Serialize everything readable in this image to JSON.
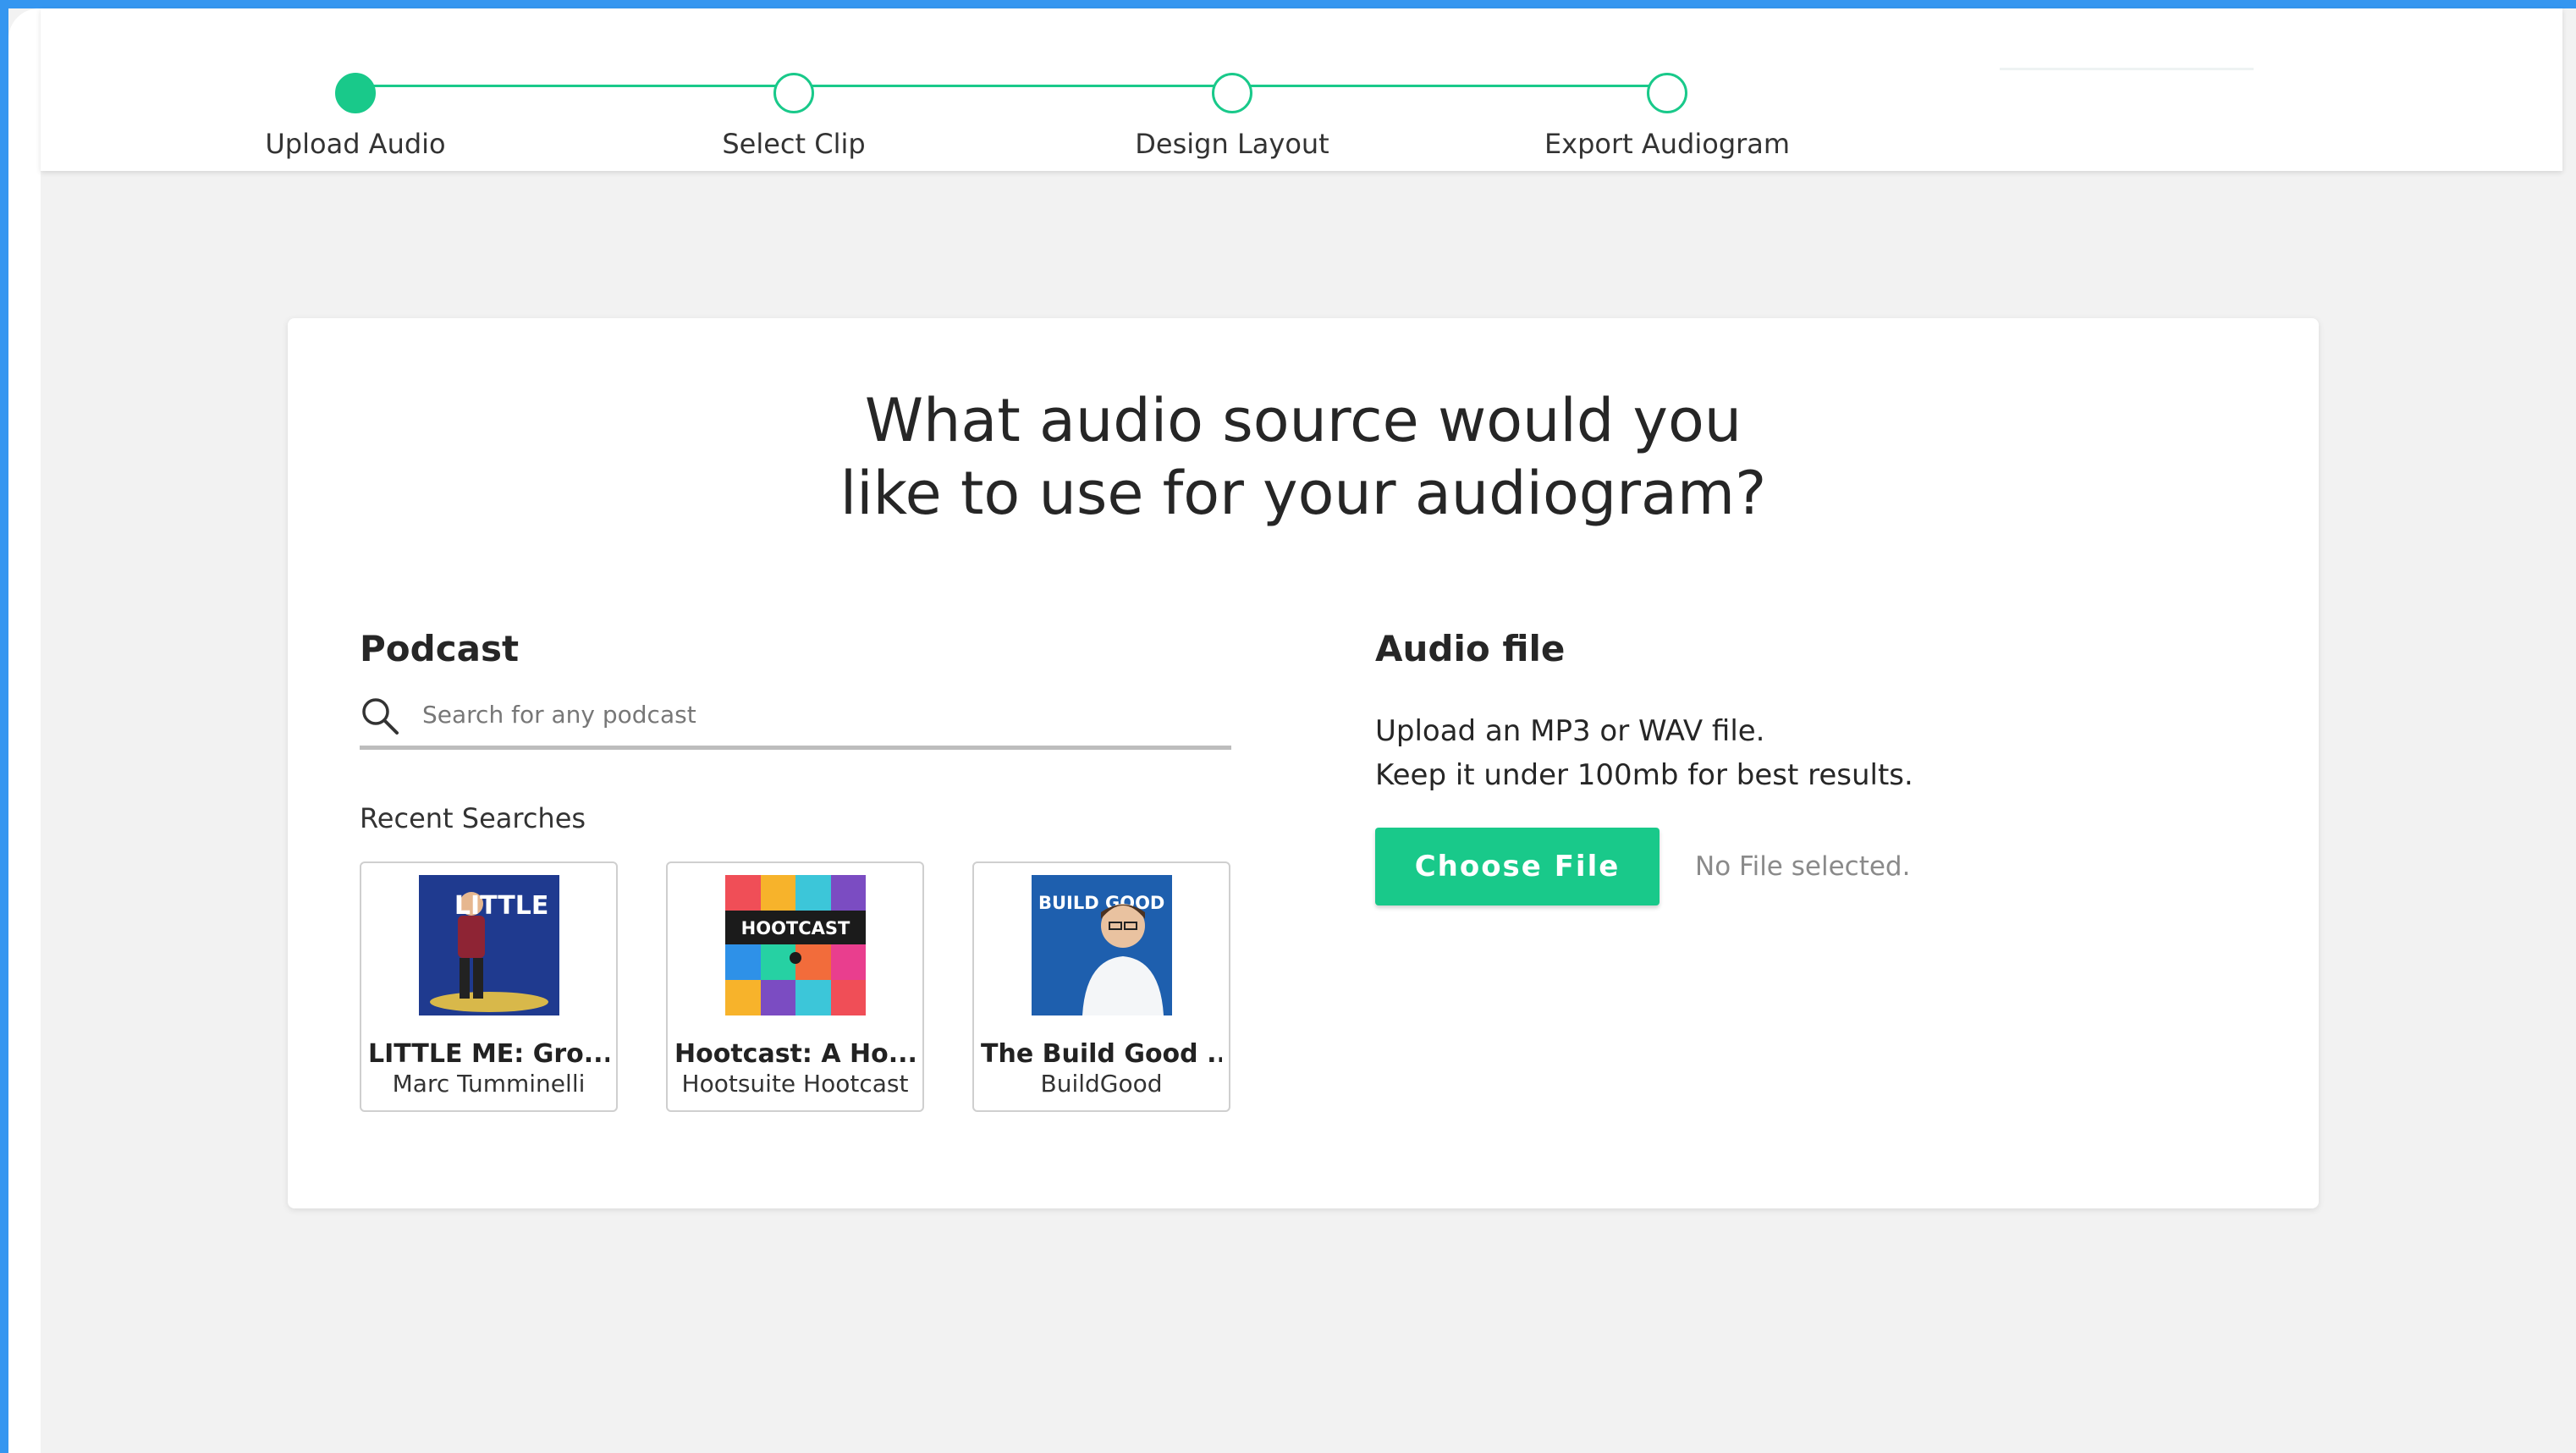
{
  "stepper": {
    "steps": [
      {
        "label": "Upload Audio",
        "active": true
      },
      {
        "label": "Select Clip",
        "active": false
      },
      {
        "label": "Design Layout",
        "active": false
      },
      {
        "label": "Export Audiogram",
        "active": false
      }
    ],
    "accent_color": "#19c98a"
  },
  "main": {
    "title_line1": "What audio source would you",
    "title_line2": "like to use for your audiogram?"
  },
  "podcast": {
    "heading": "Podcast",
    "search_placeholder": "Search for any podcast",
    "search_value": "",
    "recent_label": "Recent Searches",
    "recent": [
      {
        "title": "LITTLE ME: Gro...",
        "author": "Marc Tumminelli",
        "art_text": "LITTLE ME"
      },
      {
        "title": "Hootcast: A Ho...",
        "author": "Hootsuite Hootcast",
        "art_text": "HOOTCAST"
      },
      {
        "title": "The Build Good ...",
        "author": "BuildGood",
        "art_text": "BUILD GOOD"
      }
    ]
  },
  "audio_file": {
    "heading": "Audio file",
    "desc_line1": "Upload an MP3 or WAV file.",
    "desc_line2": "Keep it under 100mb for best results.",
    "button_label": "Choose File",
    "status": "No File selected."
  },
  "colors": {
    "frame": "#3596f0",
    "background": "#f2f2f2",
    "button": "#19c98a"
  }
}
